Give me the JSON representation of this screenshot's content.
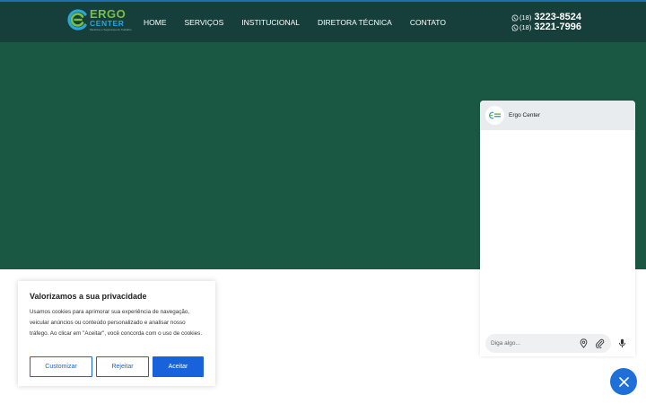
{
  "header": {
    "logo": {
      "primary": "ERGO",
      "secondary": "CENTER",
      "tagline": "Medicina e Segurança do Trabalho"
    },
    "nav": [
      {
        "label": "HOME"
      },
      {
        "label": "SERVIÇOS"
      },
      {
        "label": "INSTITUCIONAL"
      },
      {
        "label": "DIRETORA TÉCNICA"
      },
      {
        "label": "CONTATO"
      }
    ],
    "phones": [
      {
        "ddd": "(18)",
        "number": "3223-8524",
        "icon": "whatsapp-icon"
      },
      {
        "ddd": "(18)",
        "number": "3221-7996",
        "icon": "whatsapp-icon"
      }
    ]
  },
  "cookie_banner": {
    "title": "Valorizamos a sua privacidade",
    "text": "Usamos cookies para aprimorar sua experiência de navegação, veicular anúncios ou conteúdo personalizado e analisar nosso tráfego. Ao clicar em \"Aceitar\", você concorda com o uso de cookies.",
    "buttons": {
      "customize": "Customizar",
      "reject": "Rejeitar",
      "accept": "Aceitar"
    }
  },
  "chat": {
    "name": "Ergo Center",
    "input_placeholder": "Diga algo...",
    "icons": [
      "location-pin-icon",
      "paperclip-icon",
      "microphone-icon",
      "close-icon"
    ]
  },
  "colors": {
    "header_bg": "#163f3c",
    "hero_bg": "#1b5843",
    "accent_blue": "#1863dc",
    "fab_blue": "#1e6fd8",
    "logo_green": "#79c043",
    "logo_blue": "#2aa7d6"
  }
}
